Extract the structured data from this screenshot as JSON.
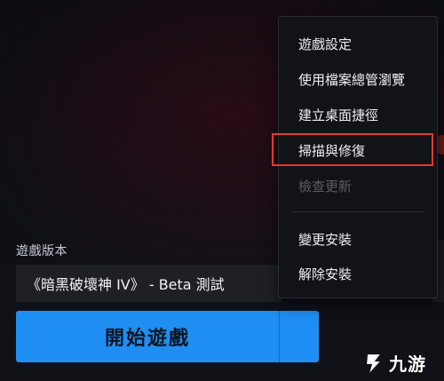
{
  "game_version": {
    "label": "遊戲版本",
    "selected": "《暗黑破壞神 IV》 - Beta 測試"
  },
  "play": {
    "button_label": "開始遊戲"
  },
  "context_menu": {
    "items": [
      {
        "label": "遊戲設定",
        "enabled": true
      },
      {
        "label": "使用檔案總管瀏覽",
        "enabled": true
      },
      {
        "label": "建立桌面捷徑",
        "enabled": true
      },
      {
        "label": "掃描與修復",
        "enabled": true,
        "highlighted": true
      },
      {
        "label": "檢查更新",
        "enabled": false
      },
      {
        "label": "變更安裝",
        "enabled": true
      },
      {
        "label": "解除安裝",
        "enabled": true
      }
    ]
  },
  "watermark": {
    "text": "九游"
  },
  "colors": {
    "accent": "#1f8ef2",
    "highlight": "#e23a32",
    "menu_bg": "#121317",
    "disabled_text": "#5b5e66"
  }
}
